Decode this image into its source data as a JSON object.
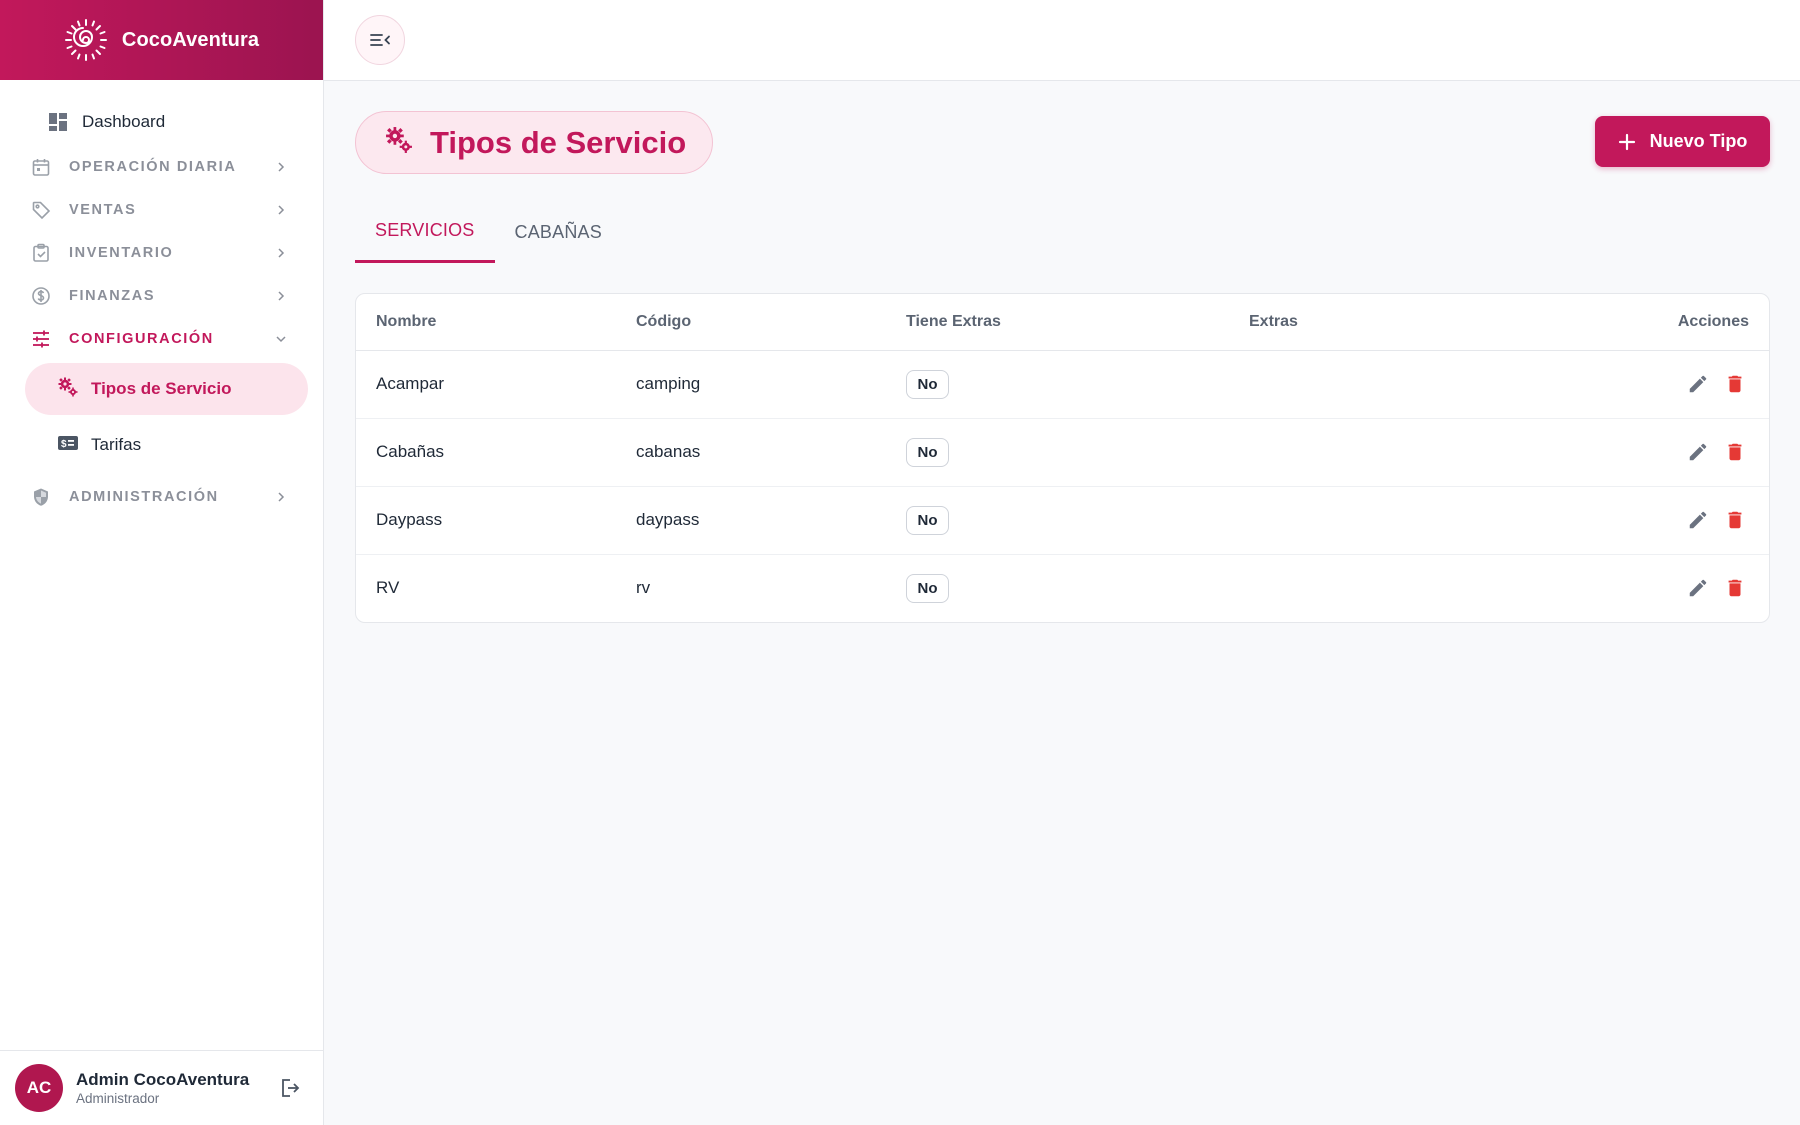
{
  "brand": {
    "name": "CocoAventura"
  },
  "sidebar": {
    "dashboard": "Dashboard",
    "sections": [
      {
        "label": "OPERACIÓN DIARIA",
        "icon": "calendar-icon"
      },
      {
        "label": "VENTAS",
        "icon": "tag-icon"
      },
      {
        "label": "INVENTARIO",
        "icon": "clipboard-check-icon"
      },
      {
        "label": "FINANZAS",
        "icon": "dollar-circle-icon"
      },
      {
        "label": "CONFIGURACIÓN",
        "icon": "sliders-icon",
        "expanded": true
      },
      {
        "label": "ADMINISTRACIÓN",
        "icon": "shield-icon"
      }
    ],
    "sub_items": [
      {
        "label": "Tipos de Servicio",
        "icon": "gears-icon",
        "active": true
      },
      {
        "label": "Tarifas",
        "icon": "price-tag-icon"
      }
    ]
  },
  "user": {
    "initials": "AC",
    "name": "Admin CocoAventura",
    "role": "Administrador"
  },
  "page": {
    "title": "Tipos de Servicio",
    "new_button": "Nuevo Tipo",
    "tabs": [
      "SERVICIOS",
      "CABAÑAS"
    ],
    "active_tab": "SERVICIOS"
  },
  "table": {
    "headers": [
      "Nombre",
      "Código",
      "Tiene Extras",
      "Extras",
      "Acciones"
    ],
    "rows": [
      {
        "nombre": "Acampar",
        "codigo": "camping",
        "tiene_extras": "No",
        "extras": ""
      },
      {
        "nombre": "Cabañas",
        "codigo": "cabanas",
        "tiene_extras": "No",
        "extras": ""
      },
      {
        "nombre": "Daypass",
        "codigo": "daypass",
        "tiene_extras": "No",
        "extras": ""
      },
      {
        "nombre": "RV",
        "codigo": "rv",
        "tiene_extras": "No",
        "extras": ""
      }
    ]
  },
  "colors": {
    "accent": "#c2185b",
    "danger": "#e53935",
    "muted": "#8b8f99"
  }
}
